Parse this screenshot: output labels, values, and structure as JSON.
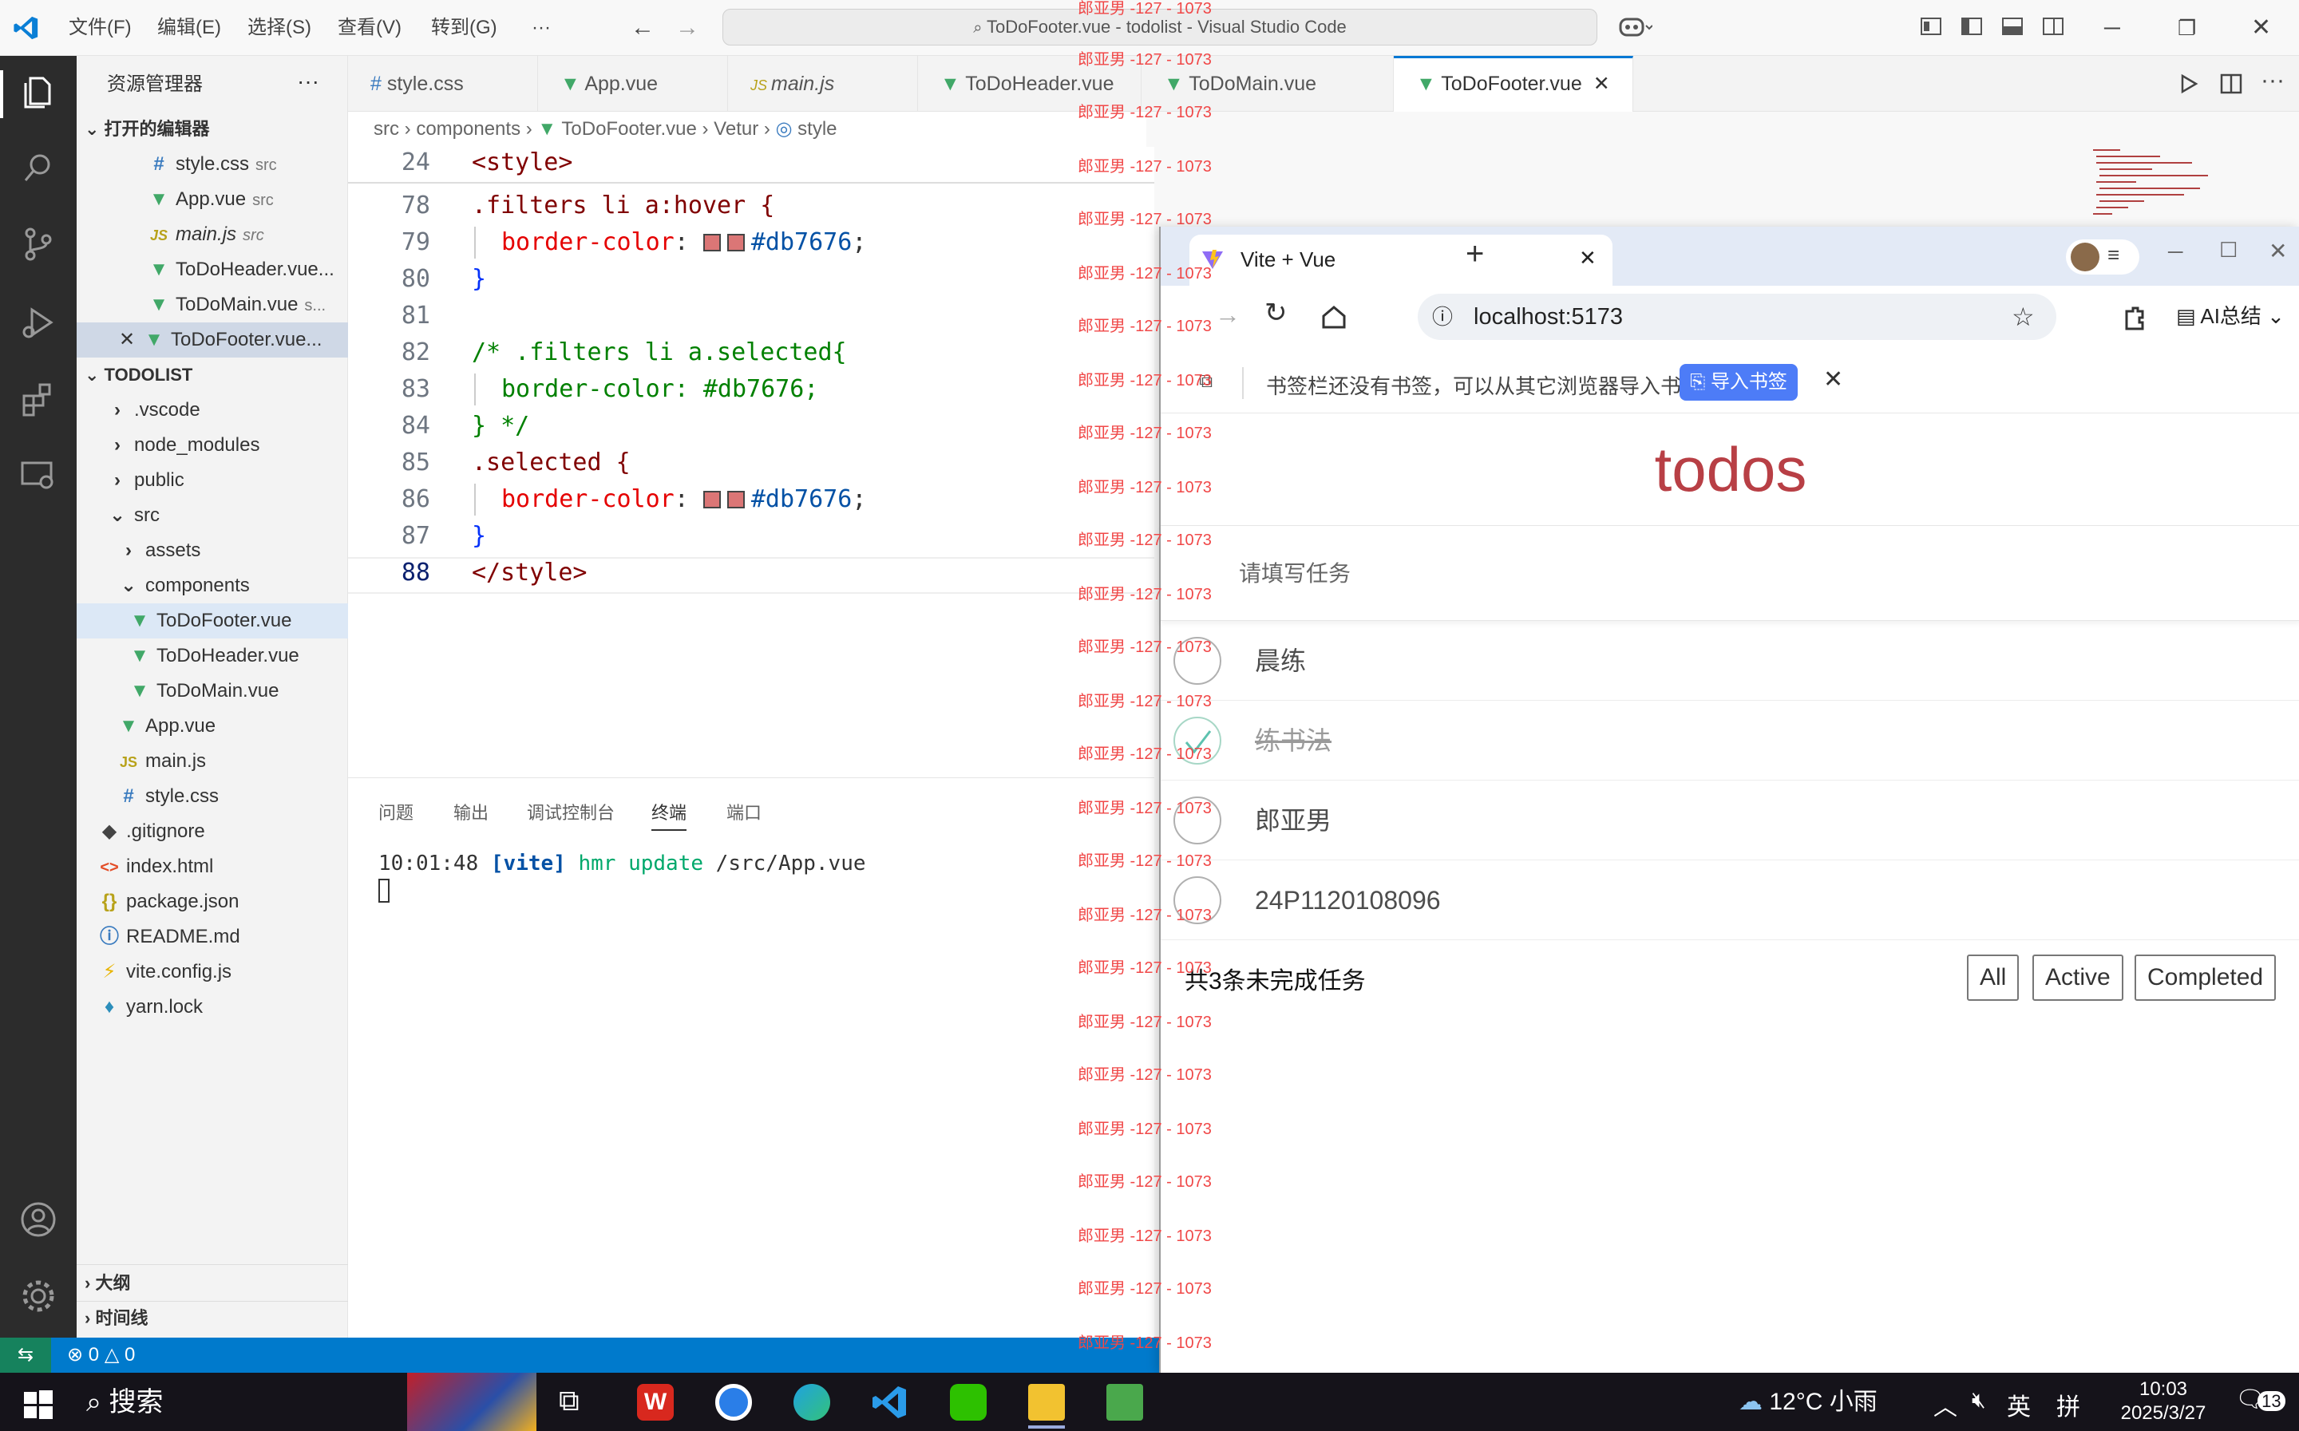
{
  "vscode": {
    "menu": [
      "文件(F)",
      "编辑(E)",
      "选择(S)",
      "查看(V)",
      "转到(G)",
      "···"
    ],
    "window_title": "ToDoFooter.vue - todolist - Visual Studio Code",
    "explorer_title": "资源管理器",
    "more": "···",
    "open_editors_label": "打开的编辑器",
    "open_editors": [
      {
        "name": "style.css",
        "sub": "src",
        "type": "css"
      },
      {
        "name": "App.vue",
        "sub": "src",
        "type": "vue"
      },
      {
        "name": "main.js",
        "sub": "src",
        "type": "js"
      },
      {
        "name": "ToDoHeader.vue...",
        "sub": "",
        "type": "vue"
      },
      {
        "name": "ToDoMain.vue",
        "sub": "s...",
        "type": "vue"
      },
      {
        "name": "ToDoFooter.vue...",
        "sub": "",
        "type": "vue"
      }
    ],
    "project_label": "TODOLIST",
    "tree": [
      {
        "name": ".vscode",
        "type": "folder"
      },
      {
        "name": "node_modules",
        "type": "folder"
      },
      {
        "name": "public",
        "type": "folder"
      },
      {
        "name": "src",
        "type": "folder-open"
      },
      {
        "name": "assets",
        "type": "folder"
      },
      {
        "name": "components",
        "type": "folder-open"
      },
      {
        "name": "ToDoFooter.vue",
        "type": "vue"
      },
      {
        "name": "ToDoHeader.vue",
        "type": "vue"
      },
      {
        "name": "ToDoMain.vue",
        "type": "vue"
      },
      {
        "name": "App.vue",
        "type": "vue"
      },
      {
        "name": "main.js",
        "type": "js"
      },
      {
        "name": "style.css",
        "type": "css"
      },
      {
        "name": ".gitignore",
        "type": "git"
      },
      {
        "name": "index.html",
        "type": "html"
      },
      {
        "name": "package.json",
        "type": "json"
      },
      {
        "name": "README.md",
        "type": "info"
      },
      {
        "name": "vite.config.js",
        "type": "vite"
      },
      {
        "name": "yarn.lock",
        "type": "yarn"
      }
    ],
    "outline_label": "大纲",
    "timeline_label": "时间线",
    "tabs": [
      {
        "label": "style.css",
        "type": "css"
      },
      {
        "label": "App.vue",
        "type": "vue"
      },
      {
        "label": "main.js",
        "type": "js"
      },
      {
        "label": "ToDoHeader.vue",
        "type": "vue"
      },
      {
        "label": "ToDoMain.vue",
        "type": "vue"
      },
      {
        "label": "ToDoFooter.vue",
        "type": "vue"
      }
    ],
    "breadcrumb": [
      "src",
      "components",
      "ToDoFooter.vue",
      "Vetur",
      "style"
    ],
    "code_lines": [
      {
        "n": "24",
        "text": "<style>"
      },
      {
        "n": "78",
        "text": ".filters li a:hover {"
      },
      {
        "n": "79",
        "text": "border-color: #db7676;"
      },
      {
        "n": "80",
        "text": "}"
      },
      {
        "n": "81",
        "text": ""
      },
      {
        "n": "82",
        "text": "/* .filters li a.selected{"
      },
      {
        "n": "83",
        "text": "border-color: #db7676;"
      },
      {
        "n": "84",
        "text": "} */"
      },
      {
        "n": "85",
        "text": ".selected {"
      },
      {
        "n": "86",
        "text": "border-color: #db7676;"
      },
      {
        "n": "87",
        "text": "}"
      },
      {
        "n": "88",
        "text": "</style>"
      }
    ],
    "panel_tabs": [
      "问题",
      "输出",
      "调试控制台",
      "终端",
      "端口"
    ],
    "terminal_line": {
      "time": "10:01:48",
      "tag": "[vite]",
      "msg": "hmr update",
      "path": "/src/App.vue"
    },
    "status": {
      "errors": "0",
      "warnings": "0"
    },
    "accent": "#007acc",
    "swatch_color": "#db7676"
  },
  "watermark": "郎亚男 -127 - 1073",
  "browser": {
    "tab_title": "Vite + Vue",
    "url": "localhost:5173",
    "ai_label": "AI总结",
    "bookmark_msg": "书签栏还没有书签，可以从其它浏览器导入书签",
    "import_label": "导入书签"
  },
  "app": {
    "title": "todos",
    "placeholder": "请填写任务",
    "items": [
      {
        "text": "晨练",
        "done": false
      },
      {
        "text": "练书法",
        "done": true
      },
      {
        "text": "郎亚男",
        "done": false
      },
      {
        "text": "24P1120108096",
        "done": false
      }
    ],
    "count_text": "共3条未完成任务",
    "filters": [
      "All",
      "Active",
      "Completed"
    ],
    "selected_filter": "All",
    "title_color": "#b83f45"
  },
  "taskbar": {
    "search": "搜索",
    "weather": "12°C 小雨",
    "ime_lang": "英",
    "ime_mode": "拼",
    "time": "10:03",
    "date": "2025/3/27",
    "notifications": "13"
  }
}
